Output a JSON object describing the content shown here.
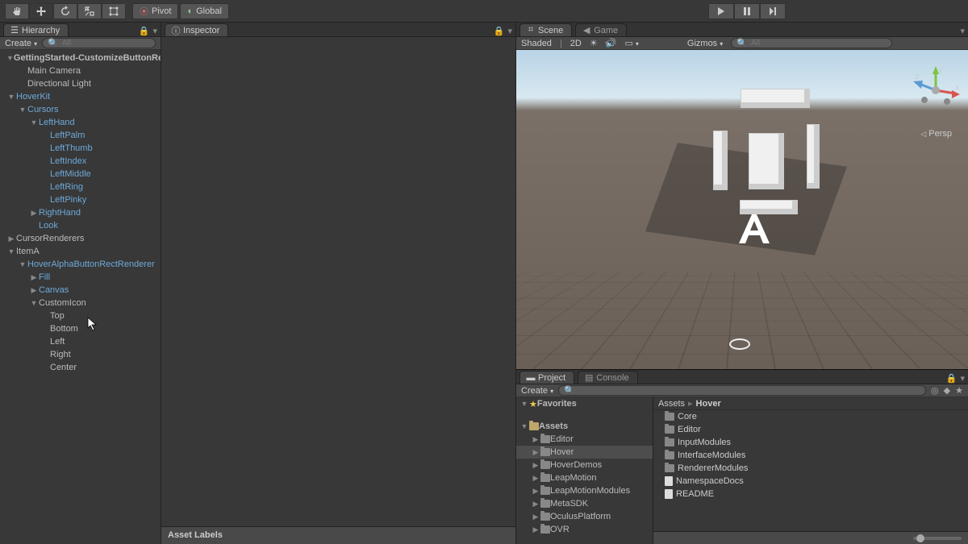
{
  "toolbar": {
    "pivot_label": "Pivot",
    "global_label": "Global"
  },
  "hierarchy": {
    "tab": "Hierarchy",
    "create": "Create",
    "search_placeholder": "All",
    "tree": [
      {
        "label": "GettingStarted-CustomizeButtonRenderer",
        "depth": 0,
        "link": false,
        "bold": true,
        "arrow": "down"
      },
      {
        "label": "Main Camera",
        "depth": 1,
        "link": false
      },
      {
        "label": "Directional Light",
        "depth": 1,
        "link": false
      },
      {
        "label": "HoverKit",
        "depth": 0,
        "link": true,
        "arrow": "down"
      },
      {
        "label": "Cursors",
        "depth": 1,
        "link": true,
        "arrow": "down"
      },
      {
        "label": "LeftHand",
        "depth": 2,
        "link": true,
        "arrow": "down"
      },
      {
        "label": "LeftPalm",
        "depth": 3,
        "link": true
      },
      {
        "label": "LeftThumb",
        "depth": 3,
        "link": true
      },
      {
        "label": "LeftIndex",
        "depth": 3,
        "link": true
      },
      {
        "label": "LeftMiddle",
        "depth": 3,
        "link": true
      },
      {
        "label": "LeftRing",
        "depth": 3,
        "link": true
      },
      {
        "label": "LeftPinky",
        "depth": 3,
        "link": true
      },
      {
        "label": "RightHand",
        "depth": 2,
        "link": true,
        "arrow": "right"
      },
      {
        "label": "Look",
        "depth": 2,
        "link": true
      },
      {
        "label": "CursorRenderers",
        "depth": 0,
        "link": false,
        "arrow": "right"
      },
      {
        "label": "ItemA",
        "depth": 0,
        "link": false,
        "arrow": "down"
      },
      {
        "label": "HoverAlphaButtonRectRenderer",
        "depth": 1,
        "link": true,
        "arrow": "down"
      },
      {
        "label": "Fill",
        "depth": 2,
        "link": true,
        "arrow": "right"
      },
      {
        "label": "Canvas",
        "depth": 2,
        "link": true,
        "arrow": "right"
      },
      {
        "label": "CustomIcon",
        "depth": 2,
        "link": false,
        "arrow": "down"
      },
      {
        "label": "Top",
        "depth": 3,
        "link": false
      },
      {
        "label": "Bottom",
        "depth": 3,
        "link": false
      },
      {
        "label": "Left",
        "depth": 3,
        "link": false
      },
      {
        "label": "Right",
        "depth": 3,
        "link": false
      },
      {
        "label": "Center",
        "depth": 3,
        "link": false
      }
    ]
  },
  "inspector": {
    "tab": "Inspector",
    "asset_labels": "Asset Labels"
  },
  "scene": {
    "scene_tab": "Scene",
    "game_tab": "Game",
    "shaded": "Shaded",
    "mode_2d": "2D",
    "gizmos": "Gizmos",
    "search_placeholder": "All",
    "persp": "Persp",
    "axis": {
      "x": "x",
      "y": "y",
      "z": "z"
    }
  },
  "project": {
    "project_tab": "Project",
    "console_tab": "Console",
    "create": "Create",
    "search_placeholder": "",
    "breadcrumb": [
      "Assets",
      "Hover"
    ],
    "favorites": "Favorites",
    "assets": "Assets",
    "tree": [
      {
        "label": "Editor",
        "depth": 1,
        "arrow": "right"
      },
      {
        "label": "Hover",
        "depth": 1,
        "arrow": "right",
        "selected": true
      },
      {
        "label": "HoverDemos",
        "depth": 1,
        "arrow": "right"
      },
      {
        "label": "LeapMotion",
        "depth": 1,
        "arrow": "right"
      },
      {
        "label": "LeapMotionModules",
        "depth": 1,
        "arrow": "right"
      },
      {
        "label": "MetaSDK",
        "depth": 1,
        "arrow": "right"
      },
      {
        "label": "OculusPlatform",
        "depth": 1,
        "arrow": "right"
      },
      {
        "label": "OVR",
        "depth": 1,
        "arrow": "right"
      }
    ],
    "list": [
      {
        "label": "Core",
        "type": "folder"
      },
      {
        "label": "Editor",
        "type": "folder"
      },
      {
        "label": "InputModules",
        "type": "folder"
      },
      {
        "label": "InterfaceModules",
        "type": "folder"
      },
      {
        "label": "RendererModules",
        "type": "folder"
      },
      {
        "label": "NamespaceDocs",
        "type": "file"
      },
      {
        "label": "README",
        "type": "file"
      }
    ]
  }
}
